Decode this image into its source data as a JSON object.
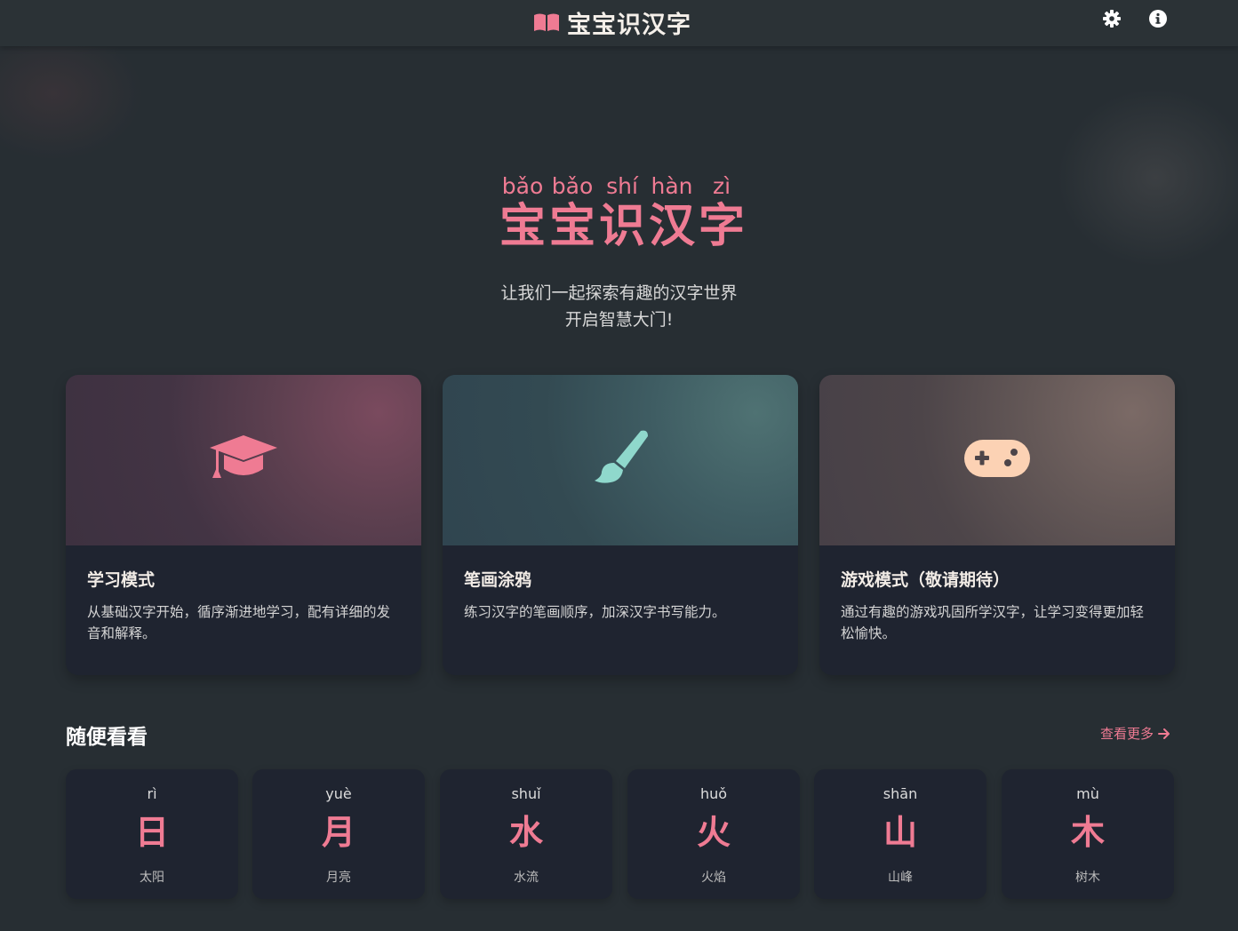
{
  "header": {
    "title": "宝宝识汉字",
    "book_icon": "open-book-icon",
    "settings_icon": "gear-icon",
    "info_icon": "info-icon"
  },
  "hero": {
    "pinyin": [
      "bǎo",
      "bǎo",
      "shí",
      "hàn",
      "zì"
    ],
    "characters": [
      "宝",
      "宝",
      "识",
      "汉",
      "字"
    ],
    "subtitle_line1": "让我们一起探索有趣的汉字世界",
    "subtitle_line2": "开启智慧大门!"
  },
  "features": [
    {
      "icon": "graduation-cap-icon",
      "title": "学习模式",
      "desc": "从基础汉字开始，循序渐进地学习，配有详细的发音和解释。",
      "color": "#ef7b93"
    },
    {
      "icon": "paint-brush-icon",
      "title": "笔画涂鸦",
      "desc": "练习汉字的笔画顺序，加深汉字书写能力。",
      "color": "#8fd8cc"
    },
    {
      "icon": "gamepad-icon",
      "title": "游戏模式（敬请期待）",
      "desc": "通过有趣的游戏巩固所学汉字，让学习变得更加轻松愉快。",
      "color": "#fcd2b4"
    }
  ],
  "browse": {
    "title": "随便看看",
    "more_label": "查看更多",
    "arrow_icon": "arrow-right-icon",
    "items": [
      {
        "pinyin": "rì",
        "char": "日",
        "meaning": "太阳"
      },
      {
        "pinyin": "yuè",
        "char": "月",
        "meaning": "月亮"
      },
      {
        "pinyin": "shuǐ",
        "char": "水",
        "meaning": "水流"
      },
      {
        "pinyin": "huǒ",
        "char": "火",
        "meaning": "火焰"
      },
      {
        "pinyin": "shān",
        "char": "山",
        "meaning": "山峰"
      },
      {
        "pinyin": "mù",
        "char": "木",
        "meaning": "树木"
      }
    ]
  },
  "colors": {
    "accent": "#ef7b93",
    "background": "#272e33",
    "card": "#1f2430"
  }
}
